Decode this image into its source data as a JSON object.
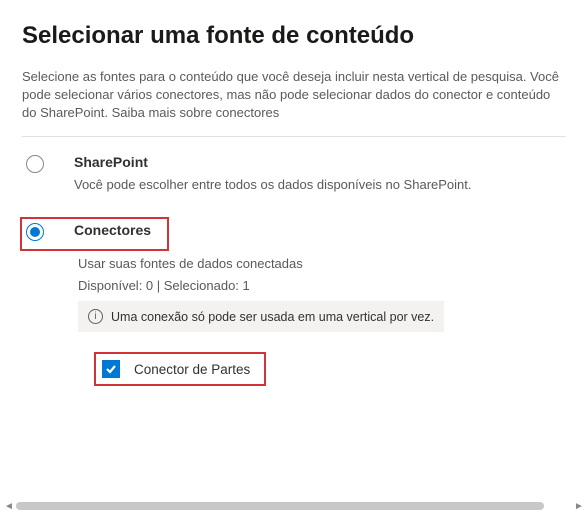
{
  "title": "Selecionar uma fonte de conteúdo",
  "description": "Selecione as fontes para o conteúdo que você deseja incluir nesta vertical de pesquisa. Você pode selecionar vários conectores, mas não pode selecionar dados do conector e conteúdo do SharePoint. Saiba mais sobre conectores",
  "options": {
    "sharepoint": {
      "label": "SharePoint",
      "description": "Você pode escolher entre todos os dados disponíveis no SharePoint.",
      "selected": false
    },
    "conectores": {
      "label": "Conectores",
      "description": "Usar suas fontes de dados conectadas",
      "meta": "Disponível: 0 | Selecionado: 1",
      "info_banner": "Uma conexão só pode ser usada em uma vertical por vez.",
      "selected": true,
      "connectors": [
        {
          "label": "Conector de Partes",
          "checked": true
        }
      ]
    }
  }
}
